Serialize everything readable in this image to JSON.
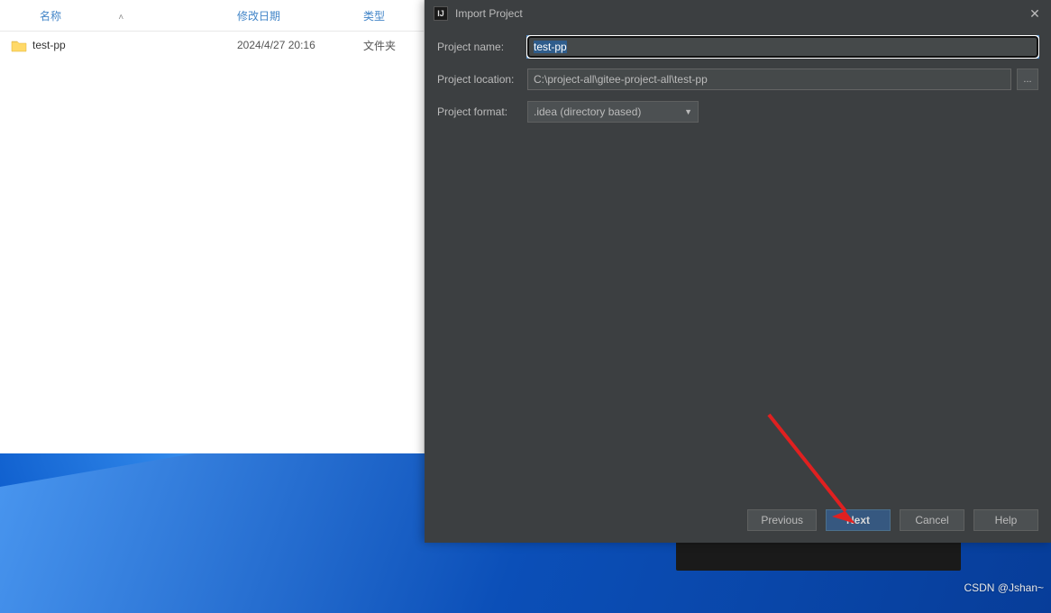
{
  "explorer": {
    "headers": {
      "name": "名称",
      "date": "修改日期",
      "type": "类型"
    },
    "rows": [
      {
        "name": "test-pp",
        "date": "2024/4/27 20:16",
        "type": "文件夹"
      }
    ]
  },
  "dialog": {
    "title": "Import Project",
    "labels": {
      "project_name": "Project name:",
      "project_location": "Project location:",
      "project_format": "Project format:"
    },
    "values": {
      "project_name": "test-pp",
      "project_location": "C:\\project-all\\gitee-project-all\\test-pp",
      "project_format": ".idea (directory based)"
    },
    "browse_label": "...",
    "buttons": {
      "previous": "Previous",
      "next": "Next",
      "cancel": "Cancel",
      "help": "Help"
    }
  },
  "watermark": "CSDN @Jshan~"
}
